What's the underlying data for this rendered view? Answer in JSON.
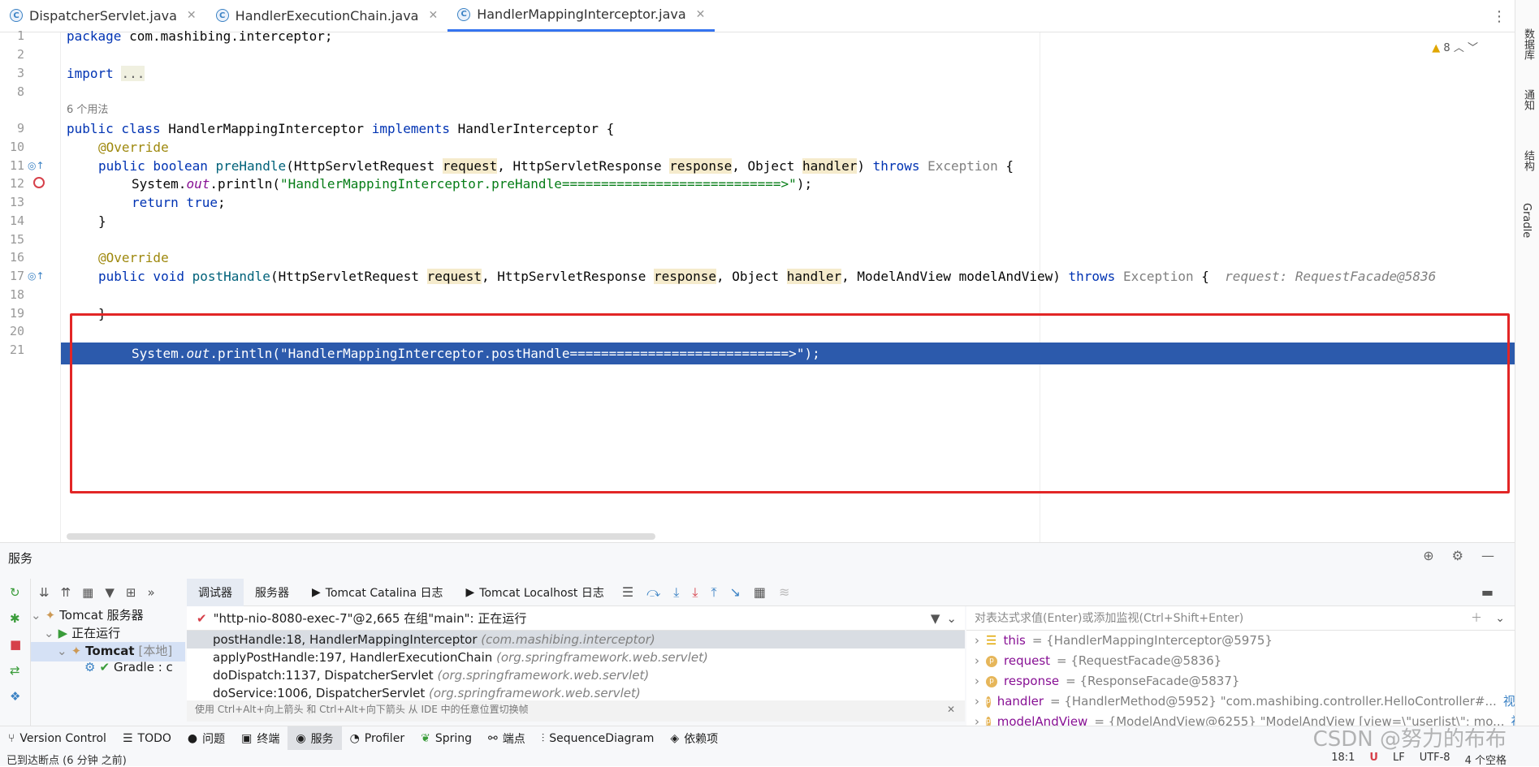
{
  "tabs": [
    {
      "label": "DispatcherServlet.java"
    },
    {
      "label": "HandlerExecutionChain.java"
    },
    {
      "label": "HandlerMappingInterceptor.java"
    }
  ],
  "editor": {
    "warning_count": "8",
    "line_numbers": [
      "1",
      "2",
      "3",
      "8",
      "9",
      "10",
      "11",
      "12",
      "13",
      "14",
      "15",
      "16",
      "17",
      "18",
      "19",
      "20",
      "21"
    ],
    "usage_hint": "6 个用法",
    "code": {
      "l1_kw": "package",
      "l1_rest": " com.mashibing.interceptor;",
      "l3_kw": "import",
      "l3_rest": "...",
      "l9_a": "public class",
      "l9_b": " HandlerMappingInterceptor ",
      "l9_c": "implements",
      "l9_d": " HandlerInterceptor {",
      "override": "@Override",
      "l11_a": "public boolean",
      "l11_b": " preHandle",
      "l11_c": "(HttpServletRequest ",
      "l11_req": "request",
      ", ": ", ",
      "l11_d": ", HttpServletResponse ",
      "l11_resp": "response",
      "l11_e": ", Object ",
      "l11_h": "handler",
      "l11_f": ") ",
      "throws": "throws",
      "exception": " Exception",
      "l11_g": " {",
      "l12_a": "System.",
      "out": "out",
      "l12_b": ".println(",
      "l12_str": "\"HandlerMappingInterceptor.preHandle============================>\"",
      "l12_c": ");",
      "l13_a": "return",
      "l13_b": " true",
      ";": ";",
      "brace": "}",
      "l17_a": "public void",
      "l17_b": " postHandle",
      "l17_c": "(HttpServletRequest ",
      "l17_req": "request",
      "l17_d": ", HttpServletResponse ",
      "l17_resp": "response",
      "l17_e": ", Object ",
      "l17_h": "handler",
      "l17_f": ", ModelAndView modelAndView) ",
      "l17_g": " {",
      "l17_inlay": "request: RequestFacade@5836",
      "l18_a": "System.",
      "l18_b": ".println(",
      "l18_str": "\"HandlerMappingInterceptor.postHandle============================>\"",
      "l18_c": ");"
    }
  },
  "services": {
    "title": "服务",
    "tree": {
      "server": "Tomcat 服务器",
      "running": "正在运行",
      "tomcat": "Tomcat",
      "tomcat_suffix": "[本地]",
      "gradle": "Gradle : c"
    },
    "debug_tabs": [
      "调试器",
      "服务器",
      "Tomcat Catalina 日志",
      "Tomcat Localhost 日志"
    ],
    "thread": "\"http-nio-8080-exec-7\"@2,665 在组\"main\": 正在运行",
    "frames": [
      {
        "method": "postHandle:18, HandlerMappingInterceptor",
        "pkg": "(com.mashibing.interceptor)"
      },
      {
        "method": "applyPostHandle:197, HandlerExecutionChain",
        "pkg": "(org.springframework.web.servlet)"
      },
      {
        "method": "doDispatch:1137, DispatcherServlet",
        "pkg": "(org.springframework.web.servlet)"
      },
      {
        "method": "doService:1006, DispatcherServlet",
        "pkg": "(org.springframework.web.servlet)"
      }
    ],
    "hint": "使用 Ctrl+Alt+向上箭头 和 Ctrl+Alt+向下箭头 从 IDE 中的任意位置切换帧",
    "eval_placeholder": "对表达式求值(Enter)或添加监视(Ctrl+Shift+Enter)",
    "variables": [
      {
        "name": "this",
        "value": "= {HandlerMappingInterceptor@5975}"
      },
      {
        "name": "request",
        "value": "= {RequestFacade@5836}"
      },
      {
        "name": "response",
        "value": "= {ResponseFacade@5837}"
      },
      {
        "name": "handler",
        "value": "= {HandlerMethod@5952} \"com.mashibing.controller.HelloController#...",
        "link": "视图"
      },
      {
        "name": "modelAndView",
        "value": "= {ModelAndView@6255} \"ModelAndView [view=\\\"userlist\\\"; mo...",
        "link": "视图"
      }
    ]
  },
  "toolwindows": [
    "Version Control",
    "TODO",
    "问题",
    "终端",
    "服务",
    "Profiler",
    "Spring",
    "端点",
    "SequenceDiagram",
    "依赖项"
  ],
  "status": {
    "left": "已到达断点 (6 分钟 之前)",
    "position": "18:1",
    "line_sep": "LF",
    "encoding": "UTF-8",
    "indent": "4 个空格"
  },
  "right_strip": [
    "数据库",
    "通知",
    "结构",
    "Gradle"
  ],
  "watermark": "CSDN @努力的布布"
}
